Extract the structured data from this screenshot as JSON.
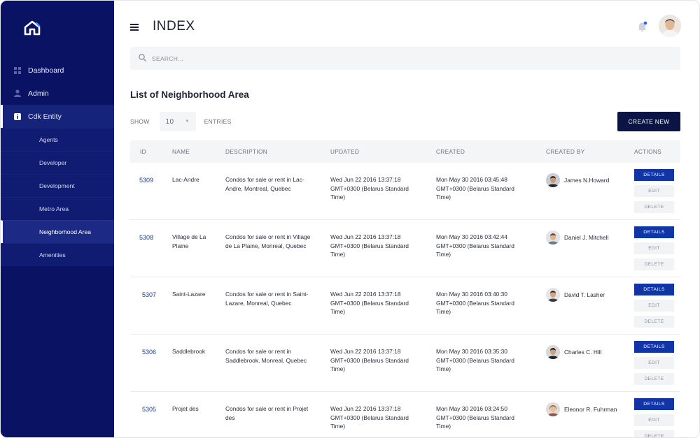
{
  "sidebar": {
    "logo_icon": "home-icon",
    "items": [
      {
        "label": "Dashboard",
        "icon": "grid-icon"
      },
      {
        "label": "Admin",
        "icon": "user-icon"
      },
      {
        "label": "Cdk Entity",
        "icon": "info-icon"
      }
    ],
    "sub_items": [
      {
        "label": "Agents"
      },
      {
        "label": "Developer"
      },
      {
        "label": "Development"
      },
      {
        "label": "Metro Area"
      },
      {
        "label": "Neighborhood Area"
      },
      {
        "label": "Amenities"
      }
    ]
  },
  "header": {
    "title": "INDEX"
  },
  "search": {
    "placeholder": "SEARCH..."
  },
  "list": {
    "title": "List of Neighborhood Area",
    "show_label": "SHOW",
    "entries_value": "10",
    "entries_label": "ENTRIES",
    "create_label": "CREATE NEW"
  },
  "table": {
    "headers": [
      "ID",
      "NAME",
      "DESCRIPTION",
      "UPDATED",
      "CREATED",
      "CREATED BY",
      "ACTIONS"
    ],
    "actions": {
      "details": "DETAILS",
      "edit": "EDIT",
      "delete": "DELETE"
    },
    "rows": [
      {
        "id": "5309",
        "name": "Lac-Andre",
        "description": "Condos for sale or rent in Lac-Andre, Montreal, Quebec",
        "updated": "Wed Jun 22 2016 13:37:18 GMT+0300 (Belarus Standard Time)",
        "created": "Mon May 30 2016 03:45:48 GMT+0300 (Belarus Standard Time)",
        "created_by": "James N.Howard"
      },
      {
        "id": "5308",
        "name": "Village de La Plaine",
        "description": "Condos for sale or rent in Village de La Plaine, Monreal, Quebec",
        "updated": "Wed Jun 22 2016 13:37:18 GMT+0300 (Belarus Standard Time)",
        "created": "Mon May 30 2016 03:42:44 GMT+0300 (Belarus Standard Time)",
        "created_by": "Daniel J. Mitchell"
      },
      {
        "id": "5307",
        "name": "Saint-Lazare",
        "description": "Condos for sale or rent in Saint-Lazare, Monreal, Quebec",
        "updated": "Wed Jun 22 2016 13:37:18 GMT+0300 (Belarus Standard Time)",
        "created": "Mon May 30 2016 03:40:30 GMT+0300 (Belarus Standard Time)",
        "created_by": "David T. Lasher"
      },
      {
        "id": "5306",
        "name": "Saddlebrook",
        "description": "Condos for sale or rent in Saddlebrook, Monreal, Quebec",
        "updated": "Wed Jun 22 2016 13:37:18 GMT+0300 (Belarus Standard Time)",
        "created": "Mon May 30 2016 03:35:30 GMT+0300 (Belarus Standard Time)",
        "created_by": "Charles C. Hill"
      },
      {
        "id": "5305",
        "name": "Projet des",
        "description": "Condos for sale or rent in Projet des",
        "updated": "Wed Jun 22 2016 13:37:18 GMT+0300 (Belarus Standard Time)",
        "created": "Mon May 30 2016 03:24:50 GMT+0300 (Belarus Standard Time)",
        "created_by": "Eleonor R. Fuhrman"
      }
    ]
  },
  "colors": {
    "sidebar_bg": "#0a1363",
    "accent": "#1036a6",
    "create_button": "#0a1545",
    "notification_dot": "#2f5bff"
  }
}
